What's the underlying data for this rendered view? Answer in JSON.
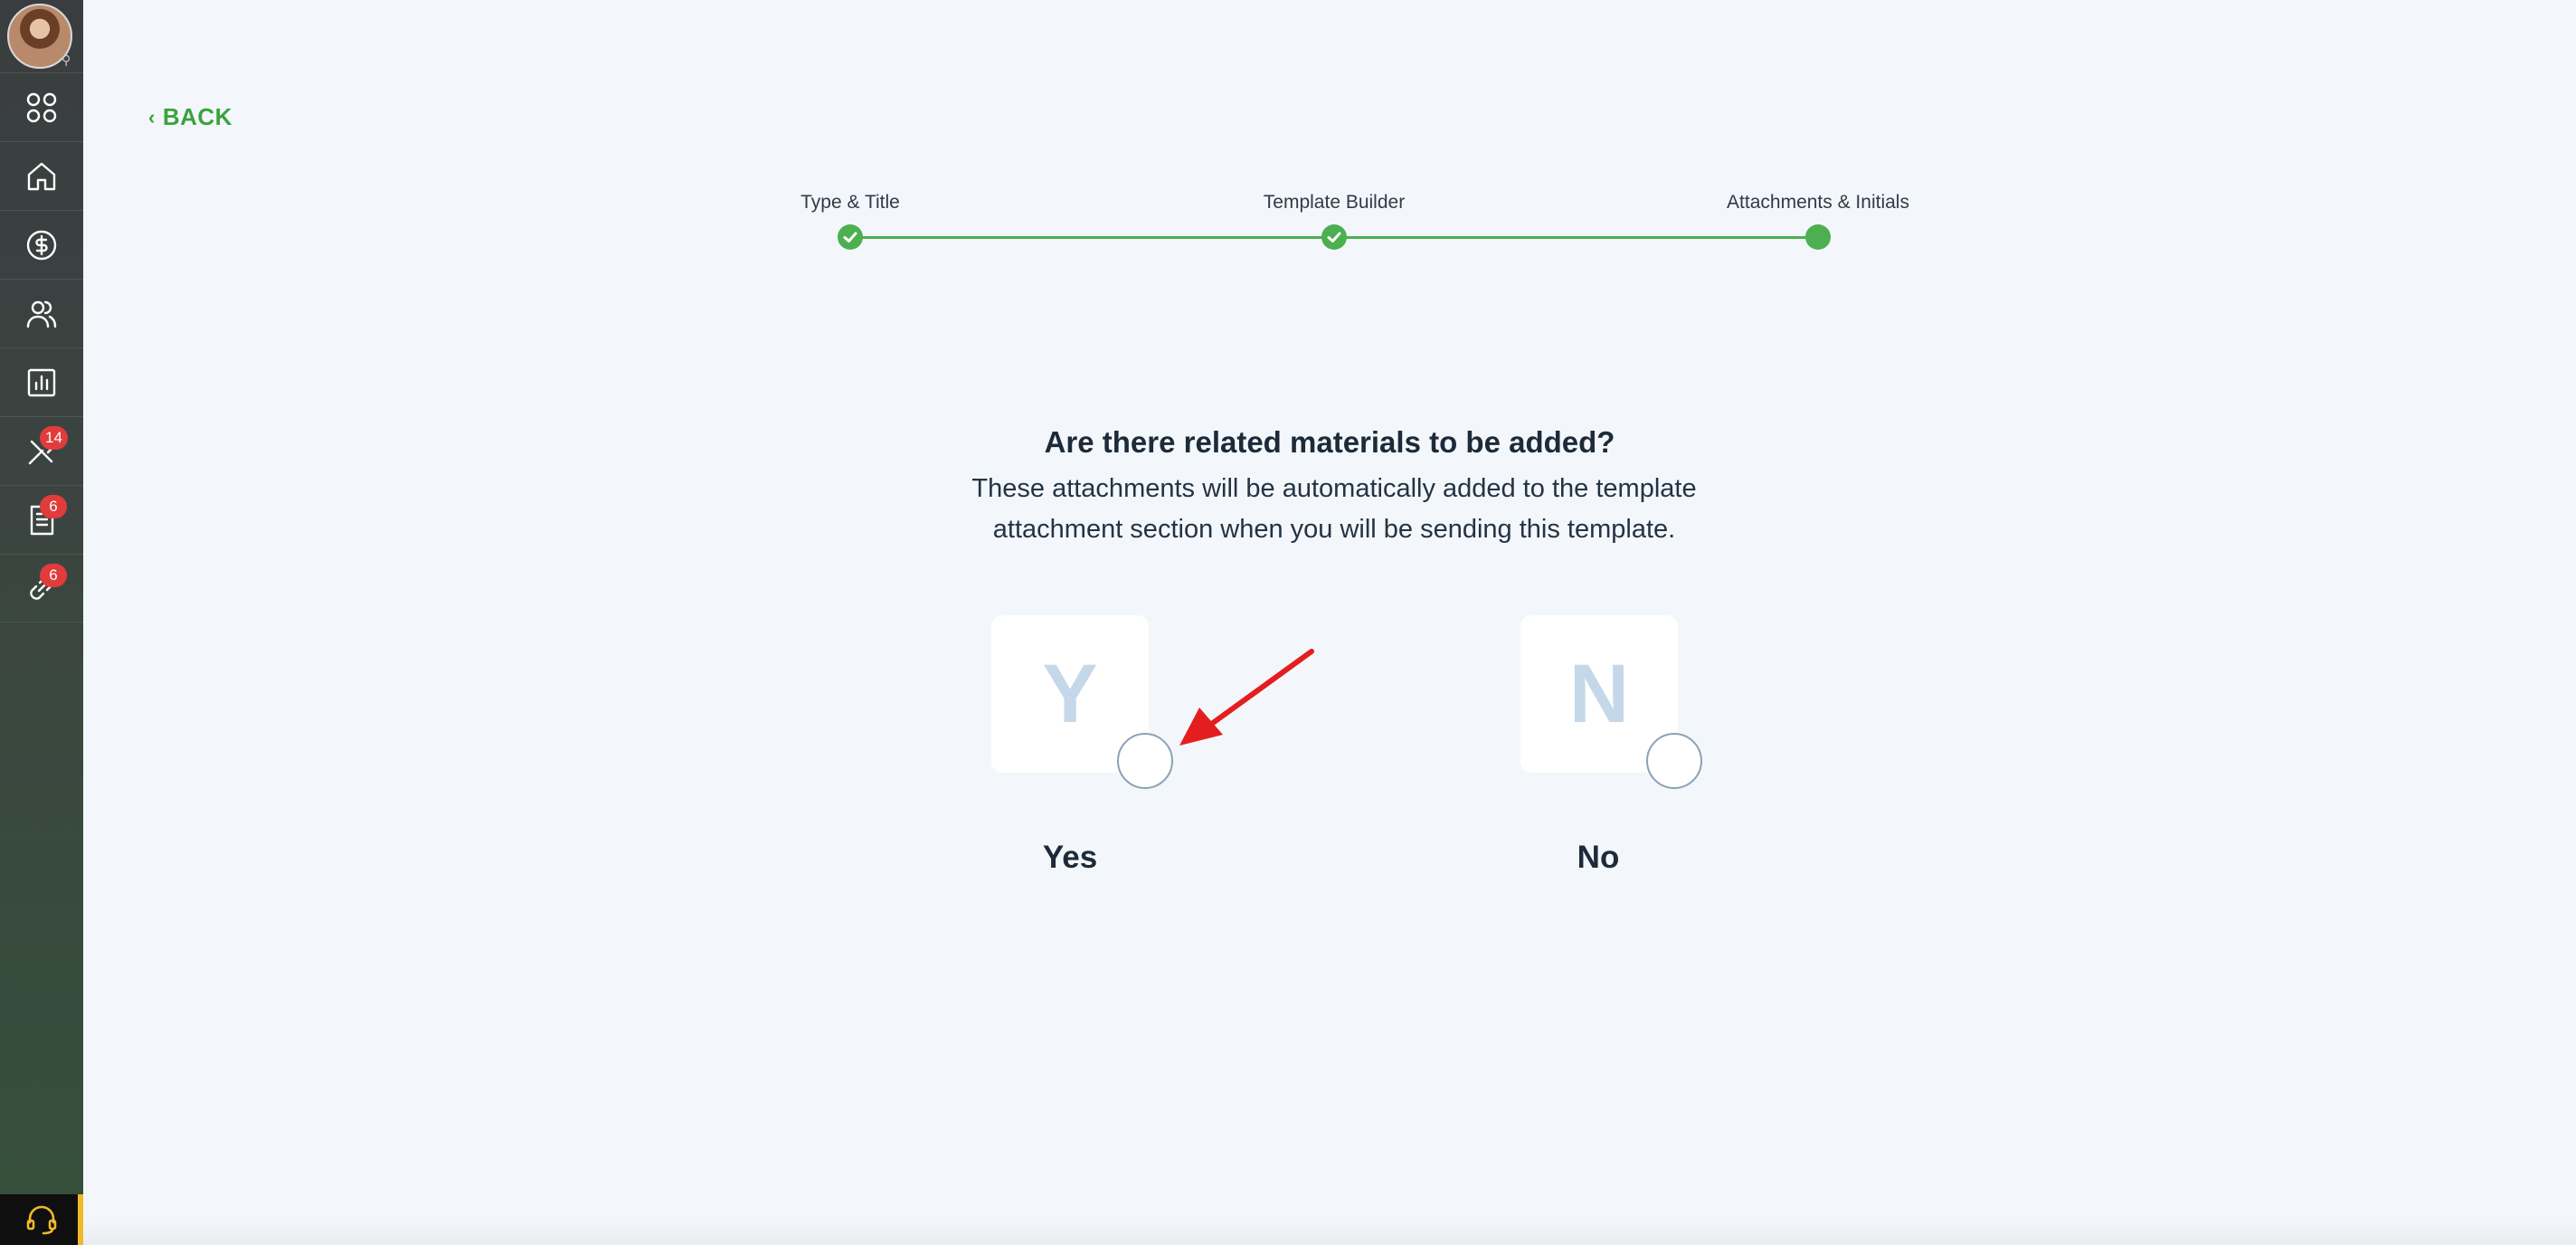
{
  "sidebar": {
    "items": [
      {
        "icon": "apps-icon"
      },
      {
        "icon": "home-icon"
      },
      {
        "icon": "dollar-icon"
      },
      {
        "icon": "users-icon"
      },
      {
        "icon": "reports-icon"
      },
      {
        "icon": "tools-icon",
        "badge": "14"
      },
      {
        "icon": "document-icon",
        "badge": "6"
      },
      {
        "icon": "link-icon",
        "badge": "6"
      }
    ],
    "support_icon": "headset-icon",
    "accent_color": "#f2b927"
  },
  "back": {
    "label": "BACK"
  },
  "stepper": {
    "steps": [
      {
        "label": "Type & Title",
        "state": "complete"
      },
      {
        "label": "Template Builder",
        "state": "complete"
      },
      {
        "label": "Attachments & Initials",
        "state": "current"
      }
    ],
    "color": "#4caf50"
  },
  "question": {
    "title": "Are there related materials to be added?",
    "subtitle": "These attachments will be automatically added to the template attachment section when you will be sending this template."
  },
  "options": [
    {
      "letter": "Y",
      "label": "Yes",
      "selected": false
    },
    {
      "letter": "N",
      "label": "No",
      "selected": false
    }
  ]
}
